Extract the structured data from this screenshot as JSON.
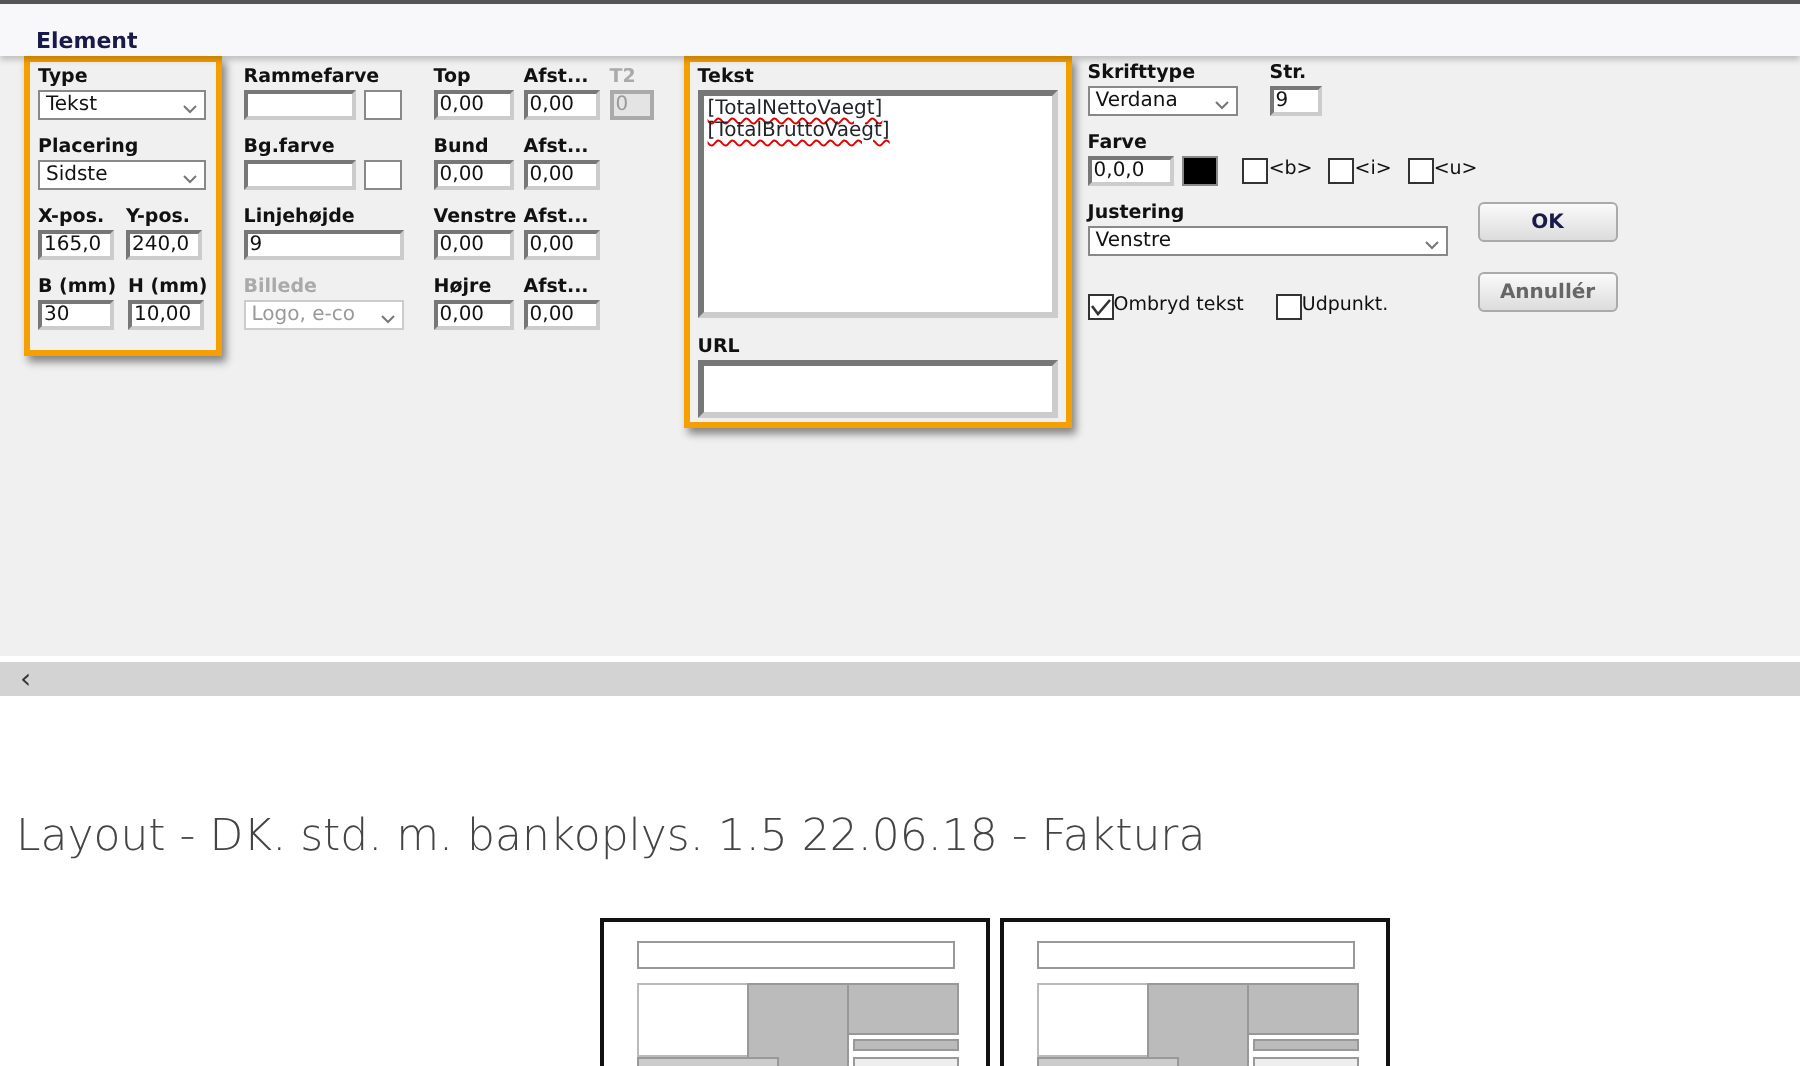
{
  "panel": {
    "title": "Element"
  },
  "position_group": {
    "highlighted": true,
    "rows": [
      [
        {
          "label": "Type",
          "kind": "select",
          "value": "Tekst",
          "disabled": false
        }
      ],
      [
        {
          "label": "Placering",
          "kind": "select",
          "value": "Sidste",
          "disabled": false
        }
      ],
      [
        {
          "label": "X-pos.",
          "kind": "input",
          "value": "165,0",
          "disabled": false
        },
        {
          "label": "Y-pos.",
          "kind": "input",
          "value": "240,0",
          "disabled": false
        }
      ],
      [
        {
          "label": "B (mm)",
          "kind": "input",
          "value": "30",
          "disabled": false
        },
        {
          "label": "H (mm)",
          "kind": "input",
          "value": "10,00",
          "disabled": false
        }
      ]
    ]
  },
  "border_group": {
    "rows": [
      [
        {
          "label": "Rammefarve",
          "kind": "color",
          "disabled": false
        },
        {
          "label": "Top",
          "kind": "input",
          "value": "0,00",
          "disabled": false
        },
        {
          "label": "Afst...",
          "kind": "input",
          "value": "0,00",
          "disabled": false
        },
        {
          "label": "T2",
          "kind": "input",
          "value": "0",
          "disabled": true
        }
      ],
      [
        {
          "label": "Bg.farve",
          "kind": "color",
          "disabled": false
        },
        {
          "label": "Bund",
          "kind": "input",
          "value": "0,00",
          "disabled": false
        },
        {
          "label": "Afst...",
          "kind": "input",
          "value": "0,00",
          "disabled": false
        }
      ],
      [
        {
          "label": "Linjehøjde",
          "kind": "input",
          "value": "9",
          "disabled": false
        },
        {
          "label": "Venstre",
          "kind": "input",
          "value": "0,00",
          "disabled": false
        },
        {
          "label": "Afst...",
          "kind": "input",
          "value": "0,00",
          "disabled": false
        }
      ],
      [
        {
          "label": "Billede",
          "kind": "select",
          "value": "Logo, e-co",
          "disabled": true
        },
        {
          "label": "Højre",
          "kind": "input",
          "value": "0,00",
          "disabled": false
        },
        {
          "label": "Afst...",
          "kind": "input",
          "value": "0,00",
          "disabled": false
        }
      ]
    ]
  },
  "text_group": {
    "highlighted": true,
    "text_label": "Tekst",
    "text_lines": [
      "[TotalNettoVaegt]",
      "[TotalBruttoVaegt]"
    ],
    "url_label": "URL"
  },
  "font_group": {
    "font_label": "Skrifttype",
    "font": "Verdana",
    "size_label": "Str.",
    "size": "9",
    "color_label": "Farve",
    "color_value": "0,0,0",
    "color": "#000000",
    "styles": [
      {
        "label": "<b>",
        "checked": false
      },
      {
        "label": "<i>",
        "checked": false
      },
      {
        "label": "<u>",
        "checked": false
      }
    ],
    "align_label": "Justering",
    "align": "Venstre",
    "options": [
      {
        "label": "Ombryd tekst",
        "checked": true
      },
      {
        "label": "Udpunkt.",
        "checked": false
      }
    ]
  },
  "buttons": [
    "OK",
    "Annullér"
  ],
  "scroll_arrow": "‹",
  "heading": "Layout - DK. std. m. bankoplys. 1.5 22.06.18 - Faktura"
}
